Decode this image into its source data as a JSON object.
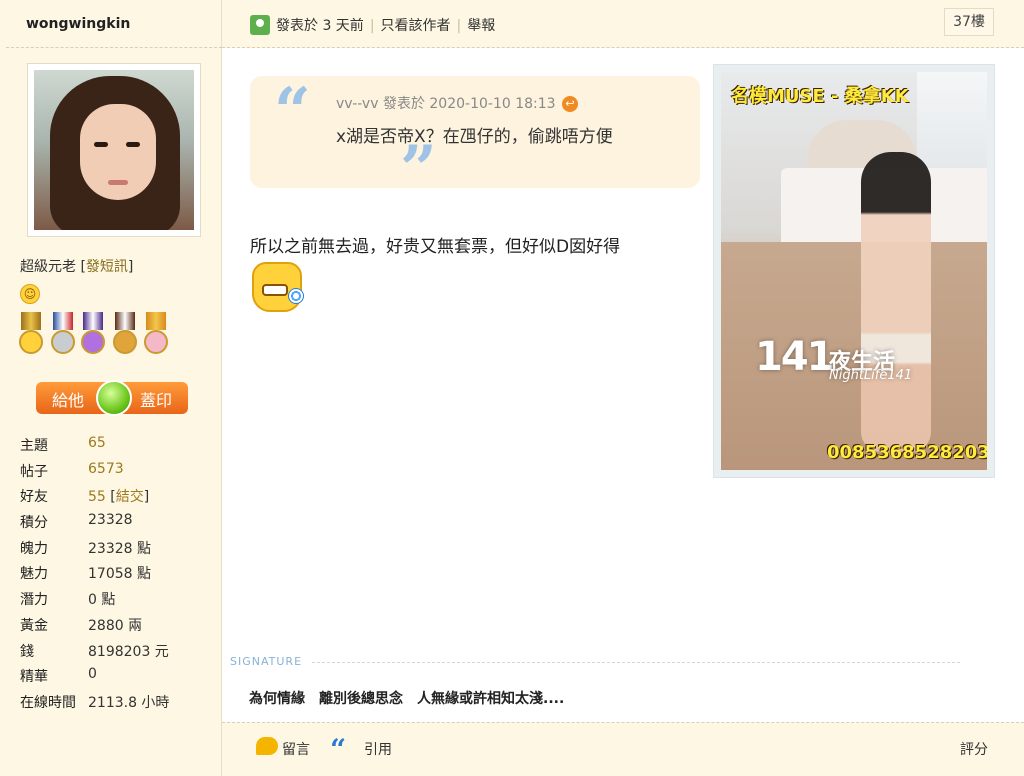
{
  "author": {
    "username": "wongwingkin",
    "rank": "超級元老",
    "pm_label": "發短訊",
    "stamp_left": "給他",
    "stamp_right": "蓋印",
    "stats": [
      {
        "label": "主題",
        "value": "65"
      },
      {
        "label": "帖子",
        "value": "6573"
      },
      {
        "label": "好友",
        "value": "55",
        "extra": "結交"
      },
      {
        "label": "積分",
        "value": "23328"
      },
      {
        "label": "魄力",
        "value": "23328 點"
      },
      {
        "label": "魅力",
        "value": "17058 點"
      },
      {
        "label": "潛力",
        "value": "0 點"
      },
      {
        "label": "黃金",
        "value": "2880 兩"
      },
      {
        "label": "錢",
        "value": "8198203 元"
      },
      {
        "label": "精華",
        "value": "0"
      },
      {
        "label": "在線時間",
        "value": "2113.8 小時"
      }
    ],
    "medals": [
      "yellow",
      "blue-red",
      "purple",
      "brown",
      "pink"
    ]
  },
  "post": {
    "posted_label": "發表於 3 天前",
    "only_author_label": "只看該作者",
    "report_label": "舉報",
    "floor": "37樓",
    "quote": {
      "author_line": "vv--vv 發表於 2020-10-10 18:13",
      "text": "x湖是否帝X？在乪仔的，偷跳唔方便"
    },
    "body": "所以之前無去過，好贵又無套票，但好似D囡好得",
    "emoji_icon": "grinning-star-lollipop-icon"
  },
  "ad": {
    "title": "名模MUSE - 桑拿KK",
    "logo_number": "141",
    "logo_cn": "夜生活",
    "logo_en": "NightLife141",
    "phone": "0085368528203"
  },
  "signature": {
    "label": "SIGNATURE",
    "text": "為何情緣　離別後總思念　人無緣或許相知太淺...."
  },
  "actions": {
    "reply_label": "留言",
    "quote_label": "引用",
    "rate_label": "評分"
  },
  "colors": {
    "panel_bg": "#fdf7e3",
    "quote_bg": "#fdf3de",
    "quote_mark": "#9ec3e6",
    "accent_gold": "#9c7a1d",
    "stamp_orange": "#e8651a"
  }
}
